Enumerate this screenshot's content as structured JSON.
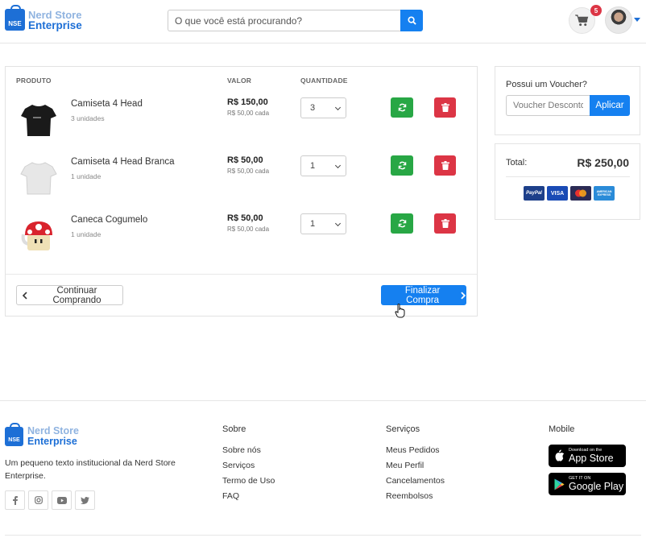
{
  "header": {
    "logo": {
      "mark": "NSE",
      "line1": "Nerd Store",
      "line2": "Enterprise"
    },
    "search": {
      "placeholder": "O que você está procurando?",
      "icon": "search-icon"
    },
    "cart_count": "5"
  },
  "cart": {
    "columns": {
      "product": "PRODUTO",
      "value": "VALOR",
      "quantity": "QUANTIDADE"
    },
    "items": [
      {
        "name": "Camiseta 4 Head",
        "units": "3 unidades",
        "price": "R$ 150,00",
        "unit_price": "R$ 50,00 cada",
        "qty": "3",
        "image": "black-tshirt"
      },
      {
        "name": "Camiseta 4 Head Branca",
        "units": "1 unidade",
        "price": "R$ 50,00",
        "unit_price": "R$ 50,00 cada",
        "qty": "1",
        "image": "white-tshirt"
      },
      {
        "name": "Caneca Cogumelo",
        "units": "1 unidade",
        "price": "R$ 50,00",
        "unit_price": "R$ 50,00 cada",
        "qty": "1",
        "image": "mushroom-mug"
      }
    ],
    "continue_label": "Continuar Comprando",
    "finish_label": "Finalizar Compra"
  },
  "voucher": {
    "title": "Possui um Voucher?",
    "placeholder": "Voucher Desconto",
    "apply_label": "Aplicar"
  },
  "summary": {
    "total_label": "Total:",
    "total_value": "R$ 250,00",
    "payment_cards": [
      "PayPal",
      "VISA",
      "",
      "AMERICAN EXPRESS"
    ]
  },
  "footer": {
    "logo": {
      "mark": "NSE",
      "line1": "Nerd Store",
      "line2": "Enterprise"
    },
    "description": "Um pequeno texto institucional da Nerd Store Enterprise.",
    "social": [
      "facebook-icon",
      "instagram-icon",
      "youtube-icon",
      "twitter-icon"
    ],
    "about": {
      "title": "Sobre",
      "links": [
        "Sobre nós",
        "Serviços",
        "Termo de Uso",
        "FAQ"
      ]
    },
    "services": {
      "title": "Serviços",
      "links": [
        "Meus Pedidos",
        "Meu Perfil",
        "Cancelamentos",
        "Reembolsos"
      ]
    },
    "mobile": {
      "title": "Mobile",
      "appstore": {
        "small": "Download on the",
        "big": "App Store"
      },
      "googleplay": {
        "small": "GET IT ON",
        "big": "Google Play"
      }
    }
  },
  "colors": {
    "primary": "#1580f0",
    "success": "#28a745",
    "danger": "#dc3545",
    "brand": "#1d6fd6"
  }
}
